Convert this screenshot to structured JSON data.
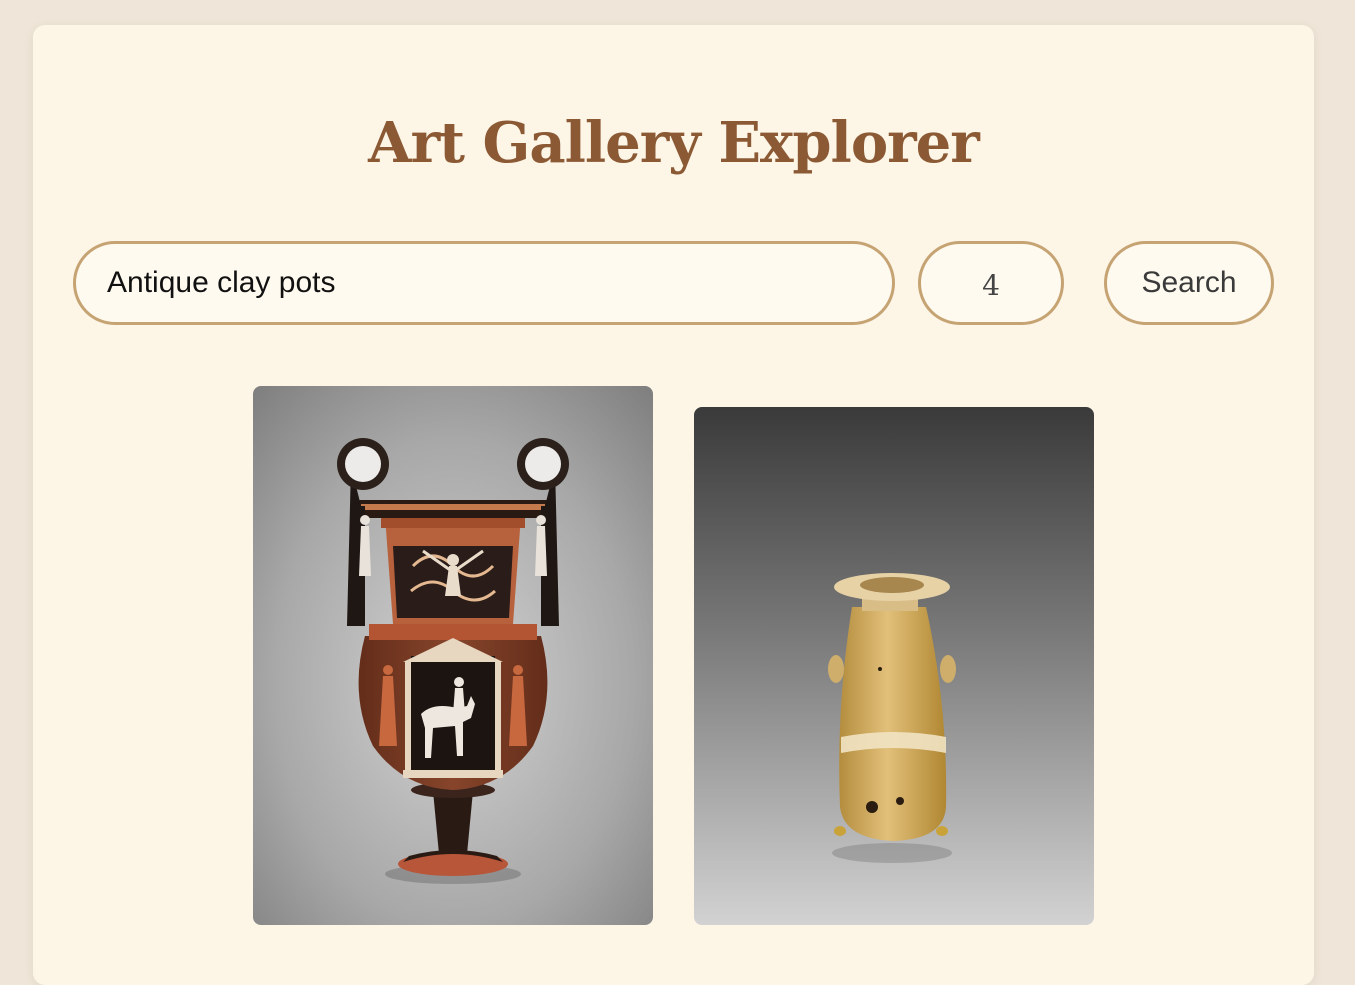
{
  "header": {
    "title": "Art Gallery Explorer"
  },
  "search": {
    "query": "Antique clay pots",
    "count": "4",
    "button_label": "Search"
  },
  "results": [
    {
      "subject": "red-figure volute krater with mascaron handles"
    },
    {
      "subject": "amber glass alabastron"
    }
  ],
  "colors": {
    "page_bg": "#efe6d9",
    "panel_bg": "#fdf5e6",
    "title": "#8b5a35",
    "field_border": "#c6a373"
  }
}
